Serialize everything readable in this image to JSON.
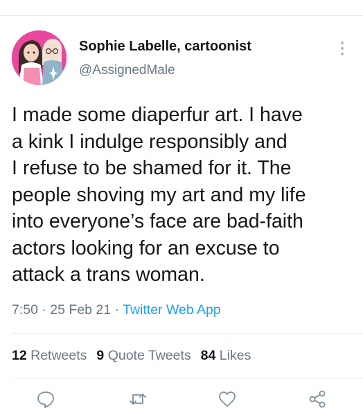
{
  "author": {
    "display_name": "Sophie Labelle, cartoonist",
    "handle": "@AssignedMale",
    "avatar_icon": "cartoon-avatar"
  },
  "tweet": {
    "lines": [
      "I made some diaperfur art. I have",
      "a kink I indulge responsibly and",
      "I refuse to be shamed for it. The",
      "people shoving my art and my life",
      "into everyone’s face are bad-faith",
      "actors looking for an excuse to",
      "attack a trans woman."
    ],
    "time": "7:50",
    "date": "25 Feb 21",
    "separator": "·",
    "source": "Twitter Web App"
  },
  "stats": {
    "retweets_count": "12",
    "retweets_label": "Retweets",
    "quote_tweets_count": "9",
    "quote_tweets_label": "Quote Tweets",
    "likes_count": "84",
    "likes_label": "Likes"
  },
  "actions": [
    "reply-icon",
    "retweet-icon",
    "like-icon",
    "share-icon"
  ],
  "colors": {
    "text": "#14171a",
    "secondary": "#657786",
    "link": "#1da1f2",
    "divider": "#e6ecf0",
    "avatar_bg": "#e8479b"
  }
}
